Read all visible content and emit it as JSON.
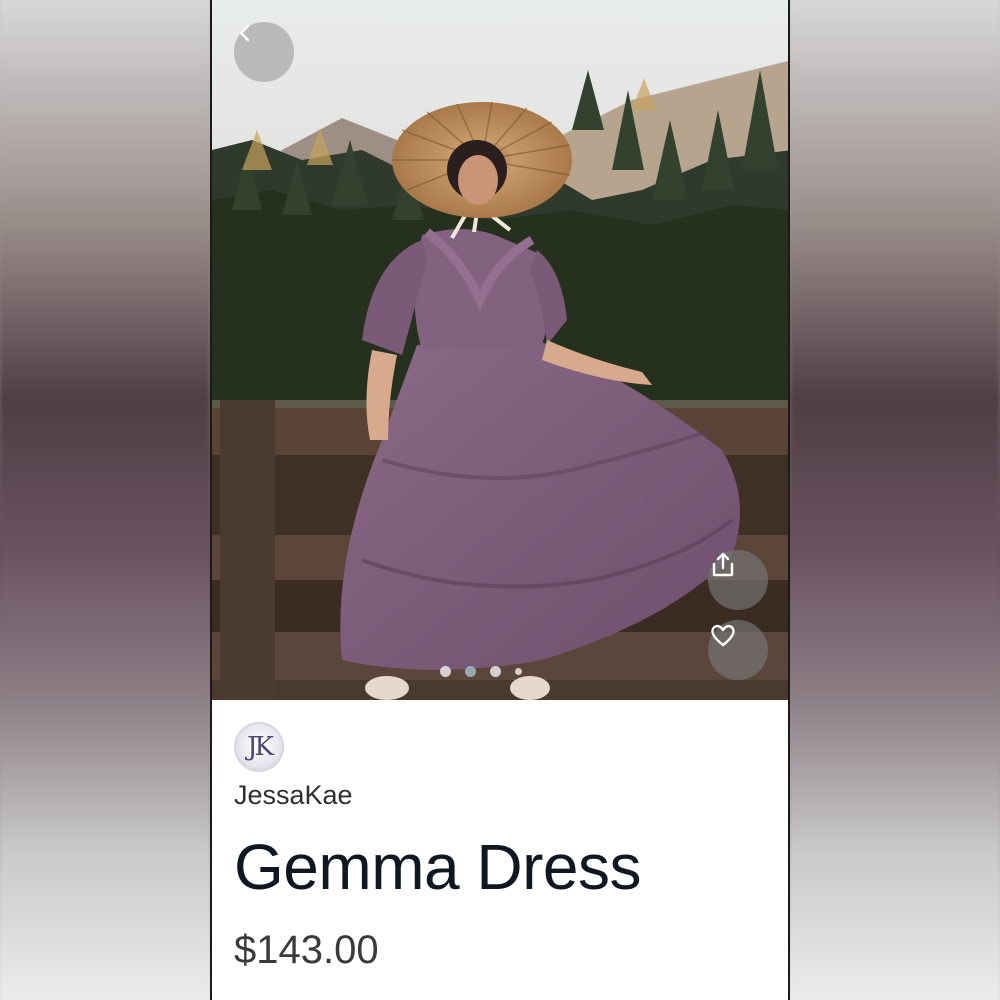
{
  "listing": {
    "seller_initials": "JK",
    "seller_name": "JessaKae",
    "product_title": "Gemma Dress",
    "price": "$143.00"
  },
  "gallery": {
    "image_count": 4,
    "active_index": 1
  },
  "icons": {
    "back": "chevron-left-icon",
    "share": "share-icon",
    "favorite": "heart-icon"
  },
  "colors": {
    "dress": "#7d5a78",
    "hat": "#b98a5a",
    "forest": "#2f3a2c",
    "title_text": "#111722"
  }
}
